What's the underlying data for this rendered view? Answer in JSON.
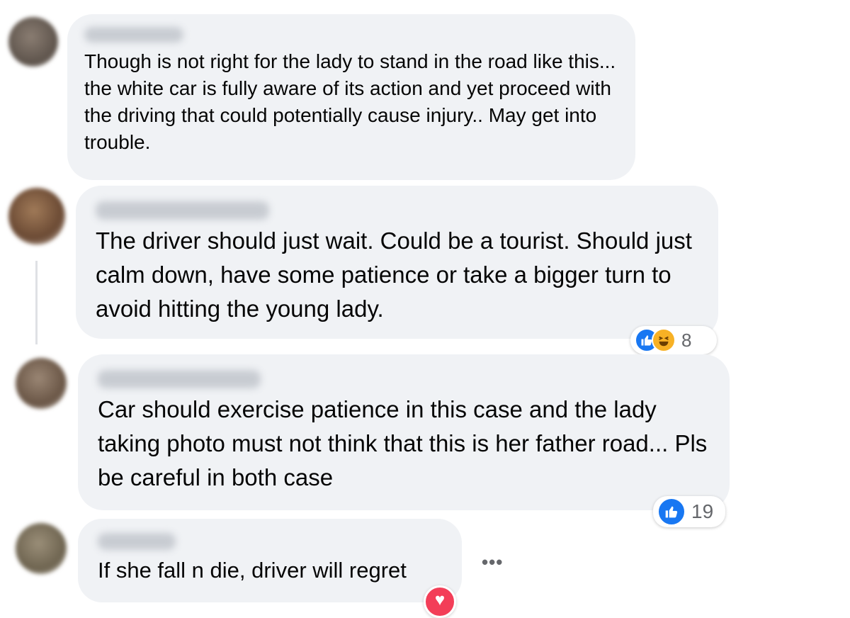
{
  "comments": [
    {
      "text": "Though is not right for the lady to stand in the road like this... the white car is fully aware of its action and yet proceed with the driving that could potentially cause injury.. May get into trouble."
    },
    {
      "text": "The driver should just wait. Could be a tourist. Should just calm down, have some patience or take a bigger turn to avoid hitting the young lady.",
      "reaction_count": "8"
    },
    {
      "text": "Car should exercise patience in this case and the lady taking photo must not think that this is her father road... Pls be careful in both case",
      "reaction_count": "19"
    },
    {
      "text": "If she fall n die, driver will regret"
    }
  ],
  "more_options": "•••",
  "icons": {
    "like": "like-icon",
    "haha": "haha-icon",
    "love": "love-icon",
    "more": "more-options-icon"
  },
  "colors": {
    "bubble": "#f0f2f5",
    "like_blue": "#1877f2",
    "love_red": "#f33e58",
    "meta_gray": "#65676b"
  }
}
